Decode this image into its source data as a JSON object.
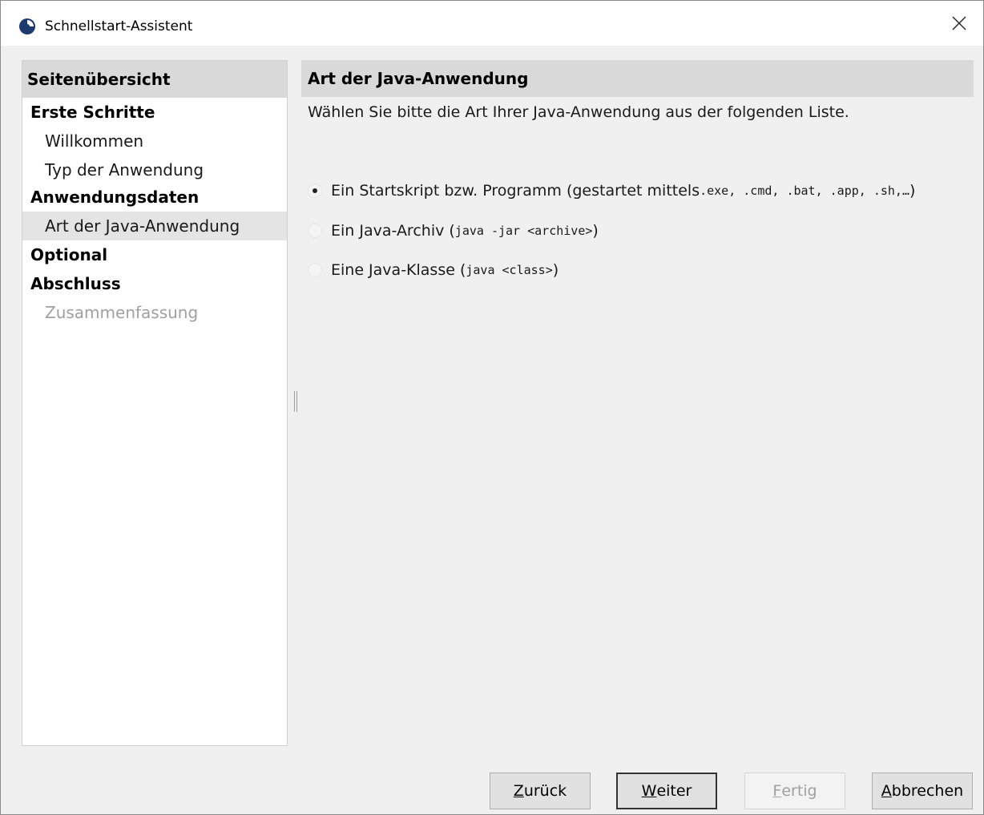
{
  "window": {
    "title": "Schnellstart-Assistent"
  },
  "sidebar": {
    "header": "Seitenübersicht",
    "items": [
      {
        "label": "Erste Schritte",
        "kind": "section"
      },
      {
        "label": "Willkommen",
        "kind": "sub"
      },
      {
        "label": "Typ der Anwendung",
        "kind": "sub"
      },
      {
        "label": "Anwendungsdaten",
        "kind": "section"
      },
      {
        "label": "Art der Java-Anwendung",
        "kind": "sub",
        "active": true
      },
      {
        "label": "Optional",
        "kind": "section"
      },
      {
        "label": "Abschluss",
        "kind": "section"
      },
      {
        "label": "Zusammenfassung",
        "kind": "sub",
        "disabled": true
      }
    ]
  },
  "main": {
    "header": "Art der Java-Anwendung",
    "description": "Wählen Sie bitte die Art Ihrer Java-Anwendung aus der folgenden Liste.",
    "options": [
      {
        "text": "Ein Startskript bzw. Programm (gestartet mittels ",
        "code": ".exe, .cmd, .bat, .app, .sh,…",
        "suffix": ")",
        "checked": true
      },
      {
        "text": "Ein Java-Archiv (",
        "code": "java -jar <archive>",
        "suffix": ")",
        "checked": false
      },
      {
        "text": "Eine Java-Klasse (",
        "code": "java <class>",
        "suffix": ")",
        "checked": false
      }
    ]
  },
  "buttons": {
    "back": {
      "mnemonic": "Z",
      "rest": "urück"
    },
    "next": {
      "mnemonic": "W",
      "rest": "eiter"
    },
    "finish": {
      "mnemonic": "F",
      "rest": "ertig"
    },
    "cancel": {
      "mnemonic": "A",
      "rest": "bbrechen"
    }
  },
  "colors": {
    "header_bg": "#d9d9d9",
    "active_item_bg": "#e4e4e4",
    "disabled_text": "#a0a0a0"
  }
}
